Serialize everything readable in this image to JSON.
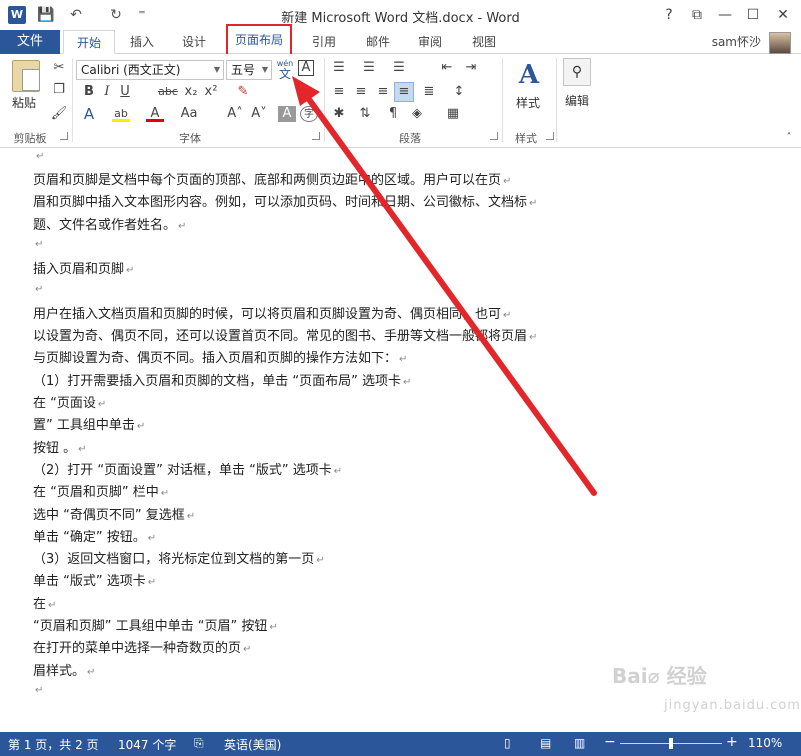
{
  "window": {
    "title": "新建 Microsoft Word 文档.docx - Word",
    "logo": "W",
    "help": "?",
    "restore_ribbon": "⧉",
    "minimize": "—",
    "maximize": "☐",
    "close": "✕"
  },
  "qat": {
    "save": "💾",
    "undo": "↶",
    "redo": "↻",
    "more": "⁼"
  },
  "tabs": {
    "file": "文件",
    "items": [
      "开始",
      "插入",
      "设计",
      "页面布局",
      "引用",
      "邮件",
      "审阅",
      "视图"
    ],
    "user": "sam怀沙"
  },
  "ribbon": {
    "clipboard": {
      "label": "剪贴板",
      "paste": "粘贴"
    },
    "font": {
      "label": "字体",
      "font_name": "Calibri (西文正文)",
      "font_size": "五号",
      "phonetic_top": "wén",
      "phonetic_bottom": "文",
      "char_border": "A",
      "bold": "B",
      "italic": "I",
      "underline": "U",
      "strike": "abc",
      "sub": "x₂",
      "sup": "x²",
      "text_effect": "A",
      "highlight": "ab",
      "font_color": "A",
      "grow": "A˄",
      "shrink": "A˅",
      "case": "Aa",
      "clear": "✎",
      "shade": "A",
      "enclose": "字"
    },
    "paragraph": {
      "label": "段落"
    },
    "styles": {
      "label": "样式",
      "button": "样式"
    },
    "editing": {
      "button": "编辑"
    }
  },
  "document": {
    "paragraphs": [
      "页眉和页脚是文档中每个页面的顶部、底部和两侧页边距中的区域。用户可以在页",
      "眉和页脚中插入文本图形内容。例如，可以添加页码、时间和日期、公司徽标、文档标",
      "题、文件名或作者姓名。",
      "",
      "插入页眉和页脚",
      "",
      "用户在插入文档页眉和页脚的时候，可以将页眉和页脚设置为奇、偶页相同，也可",
      "以设置为奇、偶页不同，还可以设置首页不同。常见的图书、手册等文档一般都将页眉",
      "与页脚设置为奇、偶页不同。插入页眉和页脚的操作方法如下：",
      "（1）打开需要插入页眉和页脚的文档，单击 “页面布局” 选项卡",
      "在 “页面设",
      "置” 工具组中单击",
      "按钮 。",
      "（2）打开 “页面设置” 对话框，单击 “版式” 选项卡",
      "在 “页眉和页脚” 栏中",
      "选中 “奇偶页不同” 复选框",
      "单击 “确定” 按钮。",
      "（3）返回文档窗口，将光标定位到文档的第一页",
      "单击 “版式” 选项卡",
      "在",
      " “页眉和页脚” 工具组中单击 “页眉” 按钮",
      "在打开的菜单中选择一种奇数页的页",
      "眉样式。",
      ""
    ],
    "para_mark": "↵"
  },
  "status": {
    "page": "第 1 页，共 2 页",
    "words": "1047 个字",
    "language": "英语(美国)",
    "zoom_minus": "−",
    "zoom_plus": "+",
    "zoom": "110%",
    "zoom_fraction": 0.5
  },
  "watermark": {
    "brand": "Bai⌀ 经验",
    "url": "jingyan.baidu.com"
  },
  "colors": {
    "accent": "#2b579a",
    "annotation": "#e3262a"
  }
}
